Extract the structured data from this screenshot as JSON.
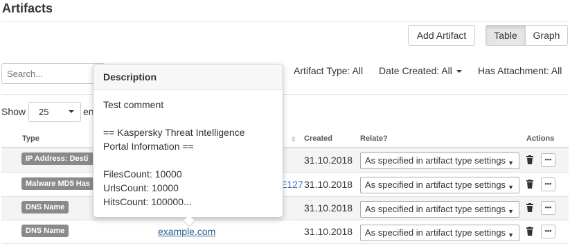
{
  "page": {
    "title": "Artifacts"
  },
  "toolbar": {
    "add_label": "Add Artifact",
    "table_label": "Table",
    "graph_label": "Graph"
  },
  "search": {
    "placeholder": "Search..."
  },
  "filters": {
    "artifact_type": "Artifact Type: All",
    "date_created": "Date Created: All",
    "has_attachment": "Has Attachment: All"
  },
  "paging": {
    "show_label": "Show",
    "page_size": "25",
    "entries_label_visible": "en"
  },
  "table": {
    "headers": {
      "type": "Type",
      "created": "Created",
      "relate": "Relate?",
      "actions": "Actions"
    },
    "rows": [
      {
        "type": "IP Address: Desti",
        "value": "",
        "created": "31.10.2018",
        "relate": "As specified in artifact type settings"
      },
      {
        "type": "Malware MD5 Has",
        "value": "E127",
        "created": "31.10.2018",
        "relate": "As specified in artifact type settings"
      },
      {
        "type": "DNS Name",
        "value": "",
        "created": "31.10.2018",
        "relate": "As specified in artifact type settings"
      },
      {
        "type": "DNS Name",
        "value": "example.com",
        "created": "31.10.2018",
        "relate": "As specified in artifact type settings"
      }
    ],
    "more_label": "•••"
  },
  "popover": {
    "title": "Description",
    "lines": [
      "Test comment",
      "",
      "== Kaspersky Threat Intelligence",
      "Portal Information ==",
      "",
      "FilesCount: 10000",
      "UrlsCount: 10000",
      "HitsCount: 100000..."
    ]
  },
  "icons": {
    "trash": "trash-icon",
    "caret": "caret-down-icon",
    "sort": "sort-icon"
  }
}
